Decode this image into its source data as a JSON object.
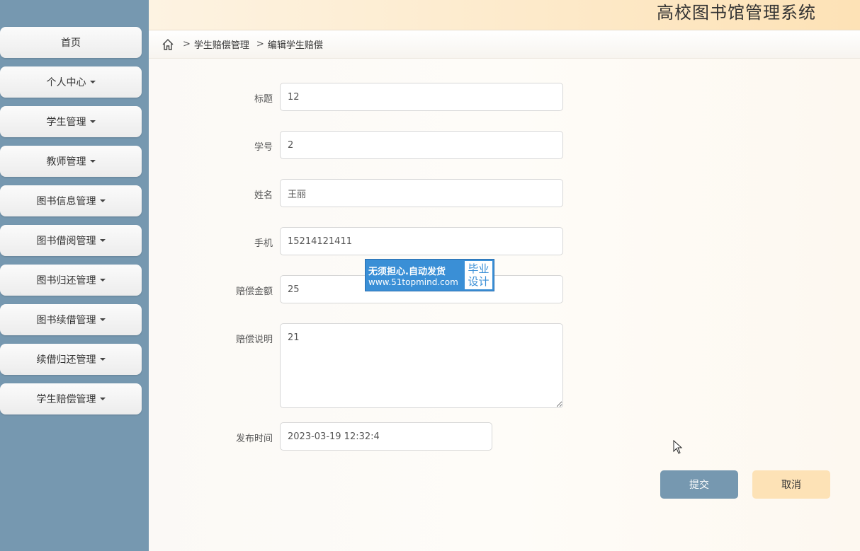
{
  "app": {
    "title": "高校图书馆管理系统"
  },
  "sidebar": {
    "items": [
      {
        "label": "首页",
        "has_dropdown": false
      },
      {
        "label": "个人中心",
        "has_dropdown": true
      },
      {
        "label": "学生管理",
        "has_dropdown": true
      },
      {
        "label": "教师管理",
        "has_dropdown": true
      },
      {
        "label": "图书信息管理",
        "has_dropdown": true
      },
      {
        "label": "图书借阅管理",
        "has_dropdown": true
      },
      {
        "label": "图书归还管理",
        "has_dropdown": true
      },
      {
        "label": "图书续借管理",
        "has_dropdown": true
      },
      {
        "label": "续借归还管理",
        "has_dropdown": true
      },
      {
        "label": "学生赔偿管理",
        "has_dropdown": true
      }
    ]
  },
  "breadcrumb": {
    "separator": ">",
    "items": [
      "学生赔偿管理",
      "编辑学生赔偿"
    ]
  },
  "form": {
    "title_label": "标题",
    "title_value": "12",
    "student_no_label": "学号",
    "student_no_value": "2",
    "name_label": "姓名",
    "name_value": "王丽",
    "phone_label": "手机",
    "phone_value": "15214121411",
    "amount_label": "赔偿金额",
    "amount_value": "25",
    "desc_label": "赔偿说明",
    "desc_value": "21",
    "time_label": "发布时间",
    "time_value": "2023-03-19 12:32:4"
  },
  "buttons": {
    "submit": "提交",
    "cancel": "取消"
  },
  "watermark": {
    "line1": "无须担心.自动发货",
    "line2": "www.51topmind.com",
    "tag1": "毕业",
    "tag2": "设计"
  },
  "colors": {
    "sidebar_bg": "#7698b0",
    "header_accent": "#fde2b6",
    "submit_bg": "#7698b0",
    "cancel_bg": "#fde2b6"
  }
}
